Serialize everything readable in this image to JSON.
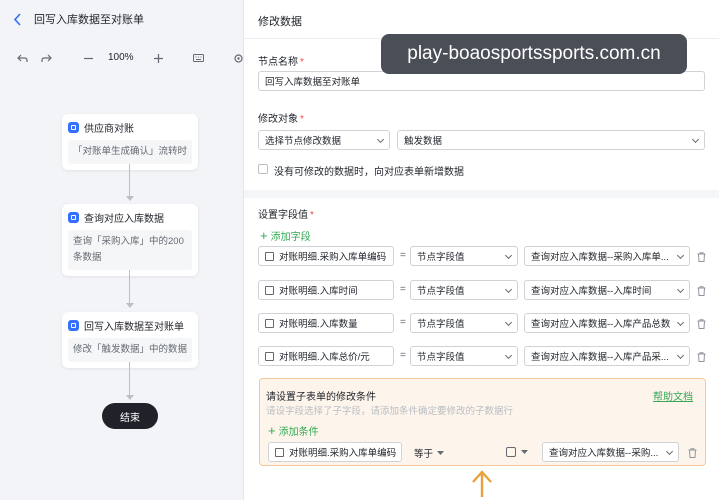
{
  "flow": {
    "title": "回写入库数据至对账单",
    "zoom": "100%",
    "nodes": [
      {
        "title": "供应商对账",
        "desc": "「对账单生成确认」流转时"
      },
      {
        "title": "查询对应入库数据",
        "desc": "查询「采购入库」中的200条数据"
      },
      {
        "title": "回写入库数据至对账单",
        "desc": "修改「触发数据」中的数据"
      }
    ],
    "end_label": "结束"
  },
  "panel": {
    "title": "修改数据",
    "node_name_label": "节点名称",
    "node_name_value": "回写入库数据至对账单",
    "target_label": "修改对象",
    "target_select": "选择节点修改数据",
    "target_data": "触发数据",
    "checkbox_label": "没有可修改的数据时，向对应表单新增数据",
    "fields_label": "设置字段值",
    "add_field": "添加字段",
    "fields": [
      {
        "name": "对账明细.采购入库单编码",
        "eq": "=",
        "mode": "节点字段值",
        "value": "查询对应入库数据--采购入库单..."
      },
      {
        "name": "对账明细.入库时间",
        "eq": "=",
        "mode": "节点字段值",
        "value": "查询对应入库数据--入库时间"
      },
      {
        "name": "对账明细.入库数量",
        "eq": "=",
        "mode": "节点字段值",
        "value": "查询对应入库数据--入库产品总数"
      },
      {
        "name": "对账明细.入库总价/元",
        "eq": "=",
        "mode": "节点字段值",
        "value": "查询对应入库数据--入库产品采..."
      }
    ],
    "condition": {
      "title": "请设置子表单的修改条件",
      "help": "帮助文档",
      "subtitle": "请设字段选择了子字段，请添加条件确定要修改的子数据行",
      "add": "添加条件",
      "field": "对账明细.采购入库单编码",
      "operator": "等于",
      "value": "查询对应入库数据--采购..."
    }
  },
  "watermark": "play-boaosportssports.com.cn",
  "colors": {
    "accent": "#3370ff",
    "green": "#34a853",
    "orange": "#e8a23d",
    "required": "#f54a45"
  }
}
